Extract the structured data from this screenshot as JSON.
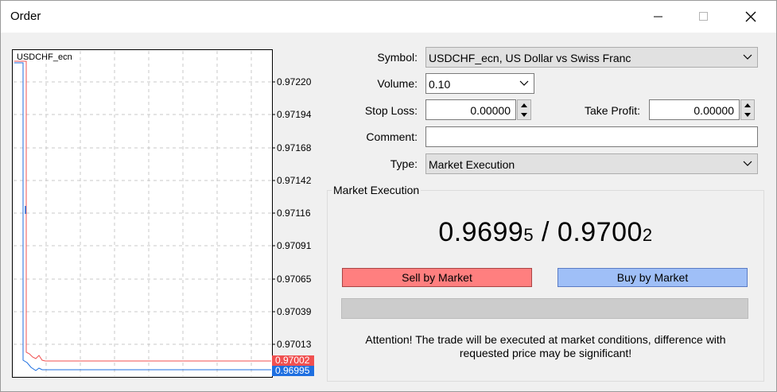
{
  "window": {
    "title": "Order"
  },
  "chart": {
    "symbol": "USDCHF_ecn",
    "price_ticks": [
      "0.97220",
      "0.97194",
      "0.97168",
      "0.97142",
      "0.97116",
      "0.97091",
      "0.97065",
      "0.97039",
      "0.97013"
    ],
    "ask_label": "0.97002",
    "bid_label": "0.96995",
    "ask_color": "#f05050",
    "bid_color": "#1e6fe0"
  },
  "form": {
    "symbol_label": "Symbol:",
    "symbol_value": "USDCHF_ecn, US Dollar vs Swiss Franc",
    "volume_label": "Volume:",
    "volume_value": "0.10",
    "stop_loss_label": "Stop Loss:",
    "stop_loss_value": "0.00000",
    "take_profit_label": "Take Profit:",
    "take_profit_value": "0.00000",
    "comment_label": "Comment:",
    "comment_value": "",
    "type_label": "Type:",
    "type_value": "Market Execution"
  },
  "execution": {
    "group_title": "Market Execution",
    "bid_main": "0.9699",
    "bid_small": "5",
    "separator": " / ",
    "ask_main": "0.9700",
    "ask_small": "2",
    "sell_label": "Sell by Market",
    "buy_label": "Buy by Market",
    "sell_color": "#ff7f7f",
    "buy_color": "#9fbff7",
    "attention_line1": "Attention! The trade will be executed at market conditions, difference with",
    "attention_line2": "requested price may be significant!"
  }
}
